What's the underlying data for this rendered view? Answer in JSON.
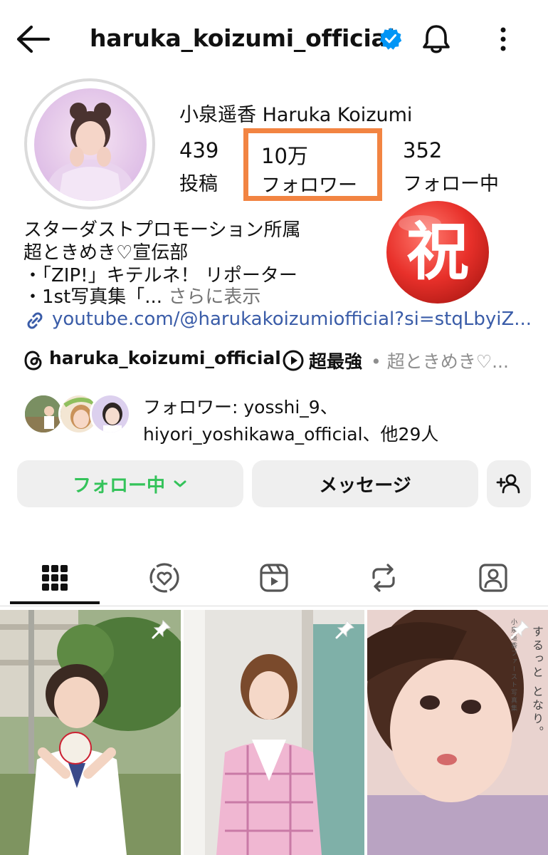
{
  "header": {
    "username": "haruka_koizumi_official"
  },
  "profile": {
    "display_name": "小泉遥香 Haruka Koizumi",
    "stats": [
      {
        "value": "439",
        "label": "投稿"
      },
      {
        "value": "10万",
        "label": "フォロワー"
      },
      {
        "value": "352",
        "label": "フォロー中"
      }
    ],
    "celebration_badge": "祝",
    "bio_lines": [
      "スターダストプロモーション所属",
      "超ときめき♡宣伝部",
      "・「ZIP!」キテルネ！ リポーター"
    ],
    "bio_truncated": "・1st写真集「...",
    "bio_more": "さらに表示",
    "link": "youtube.com/@harukakoizumiofficial?si=stqLbyiZ...",
    "threads_handle": "haruka_koizumi_official",
    "music_title": "超最強",
    "music_artist": "• 超ときめき♡...",
    "followed_by_line1": "フォロワー: yosshi_9、",
    "followed_by_line2": "hiyori_yoshikawa_official、他29人"
  },
  "actions": {
    "follow_label": "フォロー中",
    "message_label": "メッセージ"
  },
  "tabs": [
    "posts-grid",
    "collab",
    "reels",
    "reposts",
    "tagged"
  ],
  "posts": [
    {
      "pinned": true
    },
    {
      "pinned": true
    },
    {
      "pinned": true,
      "caption": "するっと となり。",
      "caption_small": "小泉遥香ファースト写真集"
    }
  ],
  "colors": {
    "highlight": "#f28442",
    "following_green": "#34c35a",
    "verified_blue": "#0095f6",
    "link_blue": "#3a5ca8",
    "badge_red": "#e8302a"
  }
}
